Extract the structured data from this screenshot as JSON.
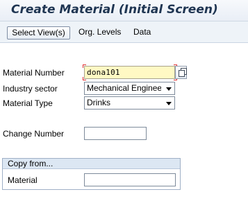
{
  "window": {
    "title": "Create Material (Initial Screen)"
  },
  "toolbar": {
    "select_views_label": "Select View(s)",
    "org_levels_label": "Org. Levels",
    "data_label": "Data"
  },
  "form": {
    "material_number": {
      "label": "Material Number",
      "value": "dona101"
    },
    "industry_sector": {
      "label": "Industry sector",
      "value": "Mechanical Enginee ..."
    },
    "material_type": {
      "label": "Material Type",
      "value": "Drinks"
    },
    "change_number": {
      "label": "Change Number",
      "value": ""
    }
  },
  "copy_from": {
    "title": "Copy from...",
    "material_label": "Material",
    "material_value": ""
  },
  "colors": {
    "title_text": "#1f3552",
    "required_field_bg": "#fff9c4",
    "required_marker": "#e03030",
    "group_header_bg": "#dce7f3"
  }
}
